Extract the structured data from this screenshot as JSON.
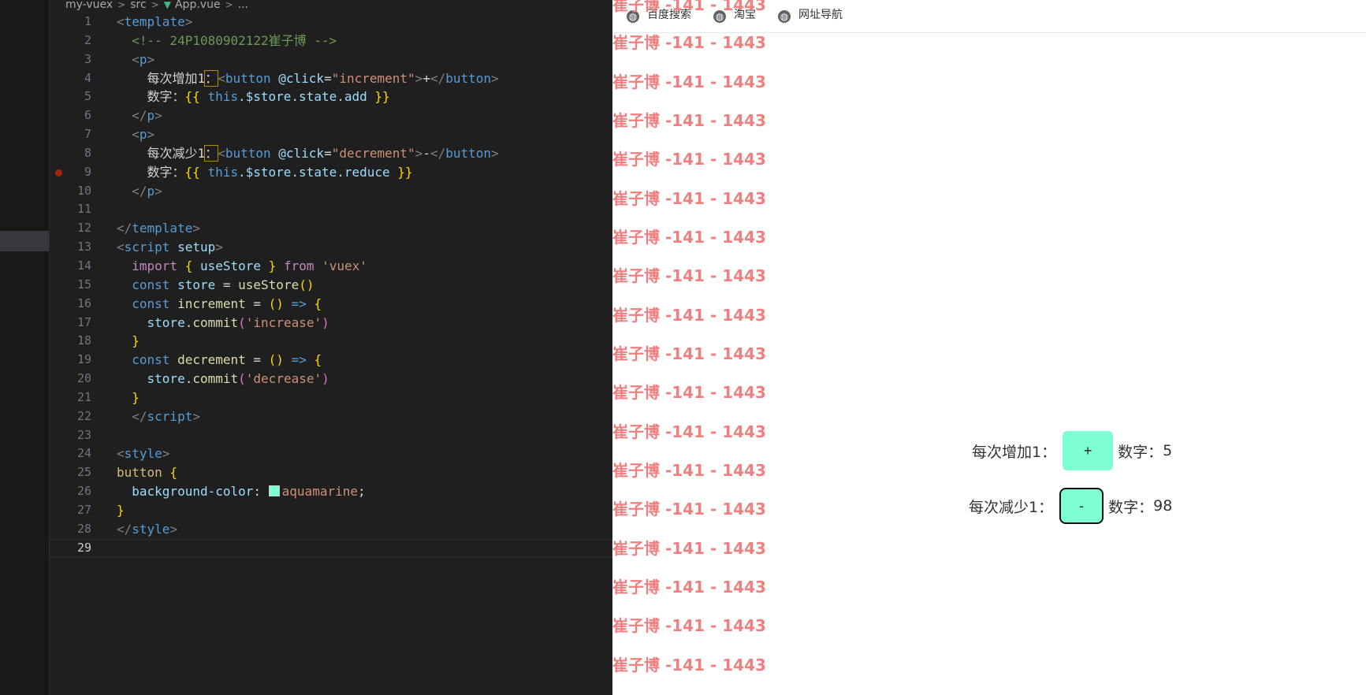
{
  "breadcrumb": {
    "folder1": "my-vuex",
    "folder2": "src",
    "file": "App.vue",
    "more": "..."
  },
  "editor": {
    "icons": {
      "breadcrumb_separator": "chevron-right-icon",
      "vue_file": "vue-file-icon",
      "breakpoint": "breakpoint-dot-icon"
    },
    "lines": [
      {
        "n": "1",
        "t": [
          [
            "<",
            "bracket"
          ],
          [
            "template",
            "tag"
          ],
          [
            ">",
            "bracket"
          ]
        ]
      },
      {
        "n": "2",
        "t": [
          [
            "  <!-- 24P1080902122崔子博 -->",
            "cm"
          ]
        ]
      },
      {
        "n": "3",
        "t": [
          [
            "  <",
            "bracket"
          ],
          [
            "p",
            "tag"
          ],
          [
            ">",
            "bracket"
          ]
        ]
      },
      {
        "n": "4",
        "t": [
          [
            "    每次增加1",
            "ev"
          ],
          [
            "：",
            "hl"
          ],
          [
            "<",
            "bracket"
          ],
          [
            "button",
            "tag"
          ],
          [
            " @click",
            "attr"
          ],
          [
            "=",
            "ev"
          ],
          [
            "\"increment\"",
            "str"
          ],
          [
            ">",
            "bracket"
          ],
          [
            "+",
            "ev"
          ],
          [
            "</",
            "bracket"
          ],
          [
            "button",
            "tag"
          ],
          [
            ">",
            "bracket"
          ]
        ]
      },
      {
        "n": "5",
        "t": [
          [
            "    数字：",
            "ev"
          ],
          [
            "{{ ",
            "br1"
          ],
          [
            "this",
            "kw"
          ],
          [
            ".$store.state.add",
            "var"
          ],
          [
            " }}",
            "br1"
          ]
        ]
      },
      {
        "n": "6",
        "t": [
          [
            "  </",
            "bracket"
          ],
          [
            "p",
            "tag"
          ],
          [
            ">",
            "bracket"
          ]
        ]
      },
      {
        "n": "7",
        "t": [
          [
            "  <",
            "bracket"
          ],
          [
            "p",
            "tag"
          ],
          [
            ">",
            "bracket"
          ]
        ]
      },
      {
        "n": "8",
        "t": [
          [
            "    每次减少1",
            "ev"
          ],
          [
            "：",
            "hl"
          ],
          [
            "<",
            "bracket"
          ],
          [
            "button",
            "tag"
          ],
          [
            " @click",
            "attr"
          ],
          [
            "=",
            "ev"
          ],
          [
            "\"decrement\"",
            "str"
          ],
          [
            ">",
            "bracket"
          ],
          [
            "-",
            "ev"
          ],
          [
            "</",
            "bracket"
          ],
          [
            "button",
            "tag"
          ],
          [
            ">",
            "bracket"
          ]
        ]
      },
      {
        "n": "9",
        "t": [
          [
            "    数字：",
            "ev"
          ],
          [
            "{{ ",
            "br1"
          ],
          [
            "this",
            "kw"
          ],
          [
            ".$store.state.reduce",
            "var"
          ],
          [
            " }}",
            "br1"
          ]
        ],
        "breakpoint": true
      },
      {
        "n": "10",
        "t": [
          [
            "  </",
            "bracket"
          ],
          [
            "p",
            "tag"
          ],
          [
            ">",
            "bracket"
          ]
        ]
      },
      {
        "n": "11",
        "t": []
      },
      {
        "n": "12",
        "t": [
          [
            "</",
            "bracket"
          ],
          [
            "template",
            "tag"
          ],
          [
            ">",
            "bracket"
          ]
        ]
      },
      {
        "n": "13",
        "t": [
          [
            "<",
            "bracket"
          ],
          [
            "script",
            "tag"
          ],
          [
            " setup",
            "attr"
          ],
          [
            ">",
            "bracket"
          ]
        ]
      },
      {
        "n": "14",
        "t": [
          [
            "  import",
            "kw2"
          ],
          [
            " { ",
            "br1"
          ],
          [
            "useStore",
            "var"
          ],
          [
            " } ",
            "br1"
          ],
          [
            "from",
            "kw2"
          ],
          [
            " 'vuex'",
            "str"
          ]
        ]
      },
      {
        "n": "15",
        "t": [
          [
            "  const",
            "kw"
          ],
          [
            " store ",
            "var"
          ],
          [
            "= ",
            "ev"
          ],
          [
            "useStore",
            "fn"
          ],
          [
            "()",
            "br1"
          ]
        ]
      },
      {
        "n": "16",
        "t": [
          [
            "  const",
            "kw"
          ],
          [
            " increment ",
            "fn"
          ],
          [
            "= ",
            "ev"
          ],
          [
            "() ",
            "br1"
          ],
          [
            "=> ",
            "kw"
          ],
          [
            "{",
            "br1"
          ]
        ]
      },
      {
        "n": "17",
        "t": [
          [
            "    store",
            "var"
          ],
          [
            ".",
            "ev"
          ],
          [
            "commit",
            "fn"
          ],
          [
            "(",
            "br2"
          ],
          [
            "'increase'",
            "str"
          ],
          [
            ")",
            "br2"
          ]
        ]
      },
      {
        "n": "18",
        "t": [
          [
            "  }",
            "br1"
          ]
        ]
      },
      {
        "n": "19",
        "t": [
          [
            "  const",
            "kw"
          ],
          [
            " decrement ",
            "fn"
          ],
          [
            "= ",
            "ev"
          ],
          [
            "() ",
            "br1"
          ],
          [
            "=> ",
            "kw"
          ],
          [
            "{",
            "br1"
          ]
        ]
      },
      {
        "n": "20",
        "t": [
          [
            "    store",
            "var"
          ],
          [
            ".",
            "ev"
          ],
          [
            "commit",
            "fn"
          ],
          [
            "(",
            "br2"
          ],
          [
            "'decrease'",
            "str"
          ],
          [
            ")",
            "br2"
          ]
        ]
      },
      {
        "n": "21",
        "t": [
          [
            "  }",
            "br1"
          ]
        ]
      },
      {
        "n": "22",
        "t": [
          [
            "  </",
            "bracket"
          ],
          [
            "script",
            "tag"
          ],
          [
            ">",
            "bracket"
          ]
        ]
      },
      {
        "n": "23",
        "t": []
      },
      {
        "n": "24",
        "t": [
          [
            "<",
            "bracket"
          ],
          [
            "style",
            "tag"
          ],
          [
            ">",
            "bracket"
          ]
        ]
      },
      {
        "n": "25",
        "t": [
          [
            "button",
            "sel"
          ],
          [
            " {",
            "br1"
          ]
        ]
      },
      {
        "n": "26",
        "t": [
          [
            "  background-color",
            "prop"
          ],
          [
            ": ",
            "ev"
          ],
          [
            "#swatch",
            "swatch"
          ],
          [
            "aquamarine",
            "str"
          ],
          [
            ";",
            "ev"
          ]
        ]
      },
      {
        "n": "27",
        "t": [
          [
            "}",
            "br1"
          ]
        ]
      },
      {
        "n": "28",
        "t": [
          [
            "</",
            "bracket"
          ],
          [
            "style",
            "tag"
          ],
          [
            ">",
            "bracket"
          ]
        ]
      },
      {
        "n": "29",
        "t": [],
        "current": true
      }
    ],
    "colors": {
      "swatch": "#7fffd4",
      "breakpoint": "#a1260d"
    }
  },
  "browser": {
    "bookmarks": [
      {
        "label": "百度搜索",
        "icon": "globe-icon"
      },
      {
        "label": "淘宝",
        "icon": "globe-icon"
      },
      {
        "label": "网址导航",
        "icon": "globe-icon"
      }
    ],
    "watermark": {
      "text": "崔子博 -141 - 1443",
      "color": "#f08080"
    },
    "app": {
      "row1": {
        "label": "每次增加1：",
        "button": "+",
        "count_label": "数字：",
        "count": "5"
      },
      "row2": {
        "label": "每次减少1：",
        "button": "-",
        "count_label": "数字：",
        "count": "98"
      },
      "button_color": "#7fffd4"
    }
  }
}
